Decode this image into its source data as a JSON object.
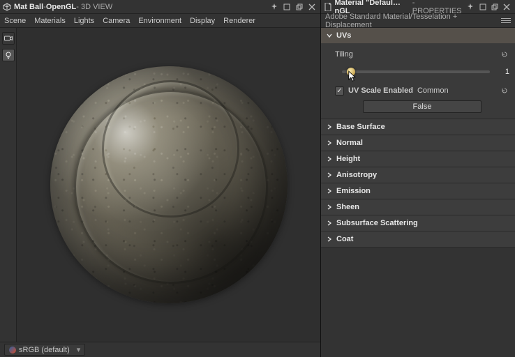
{
  "left": {
    "title_main": "Mat Ball",
    "title_sep": " - ",
    "title_renderer": "OpenGL",
    "title_suffix": " - 3D VIEW",
    "tabs": [
      "Scene",
      "Materials",
      "Lights",
      "Camera",
      "Environment",
      "Display",
      "Renderer"
    ],
    "colorspace": "sRGB (default)"
  },
  "right": {
    "title_icon_label": "Material",
    "title_main": "Material \"Defaul…nGL",
    "title_suffix": " - PROPERTIES",
    "subheader": "Adobe Standard Material/Tesselation + Displacement",
    "uvs": {
      "label": "UVs",
      "tiling_label": "Tiling",
      "tiling_value": "1",
      "uv_scale_label": "UV Scale Enabled",
      "uv_scale_mode": "Common",
      "uv_scale_value": "False",
      "uv_scale_checked": true
    },
    "groups": [
      "Base Surface",
      "Normal",
      "Height",
      "Anisotropy",
      "Emission",
      "Sheen",
      "Subsurface Scattering",
      "Coat"
    ]
  }
}
